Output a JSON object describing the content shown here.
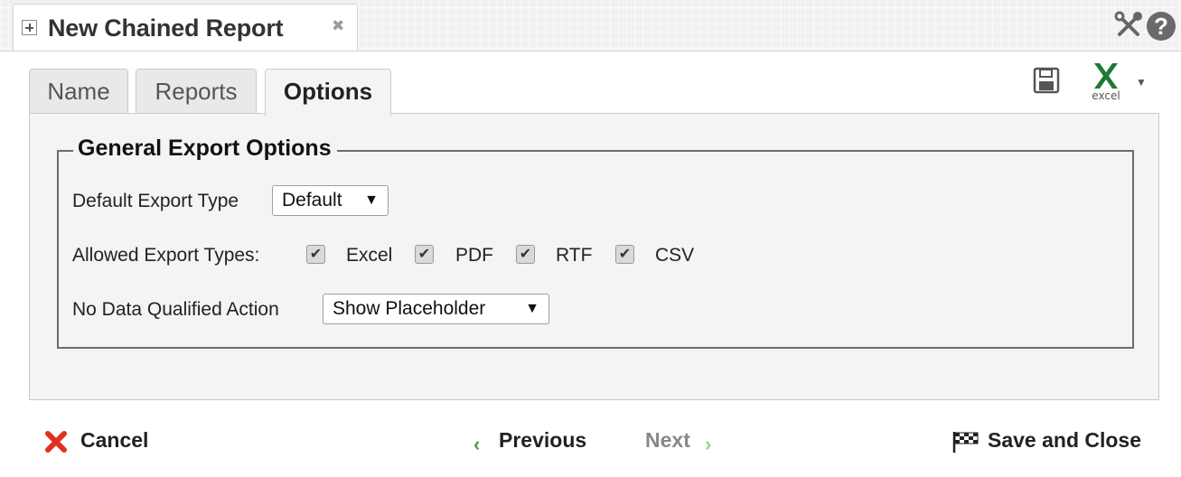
{
  "header": {
    "tab_title": "New Chained Report",
    "close_symbol": "✖",
    "help_symbol": "?"
  },
  "tabs": [
    {
      "label": "Name",
      "active": false
    },
    {
      "label": "Reports",
      "active": false
    },
    {
      "label": "Options",
      "active": true
    }
  ],
  "toolbar": {
    "save_icon": "floppy-disk-icon",
    "export_icon": "excel-icon",
    "export_caption": "excel",
    "dropdown_symbol": "▼"
  },
  "general_export_options": {
    "legend": "General Export Options",
    "default_export_type": {
      "label": "Default Export Type",
      "value": "Default"
    },
    "allowed_export_types": {
      "label": "Allowed Export Types:",
      "options": [
        {
          "label": "Excel",
          "checked": true
        },
        {
          "label": "PDF",
          "checked": true
        },
        {
          "label": "RTF",
          "checked": true
        },
        {
          "label": "CSV",
          "checked": true
        }
      ]
    },
    "no_data_qualified_action": {
      "label": "No Data Qualified Action",
      "value": "Show Placeholder"
    },
    "select_arrow": "▼",
    "check_mark": "✔"
  },
  "footer": {
    "cancel_label": "Cancel",
    "previous_label": "Previous",
    "previous_symbol": "‹",
    "next_label": "Next",
    "next_symbol": "›",
    "next_enabled": false,
    "save_close_label": "Save and Close"
  },
  "colors": {
    "cancel_red": "#e0301e",
    "nav_green": "#39a82e",
    "excel_green": "#1f7a34"
  }
}
